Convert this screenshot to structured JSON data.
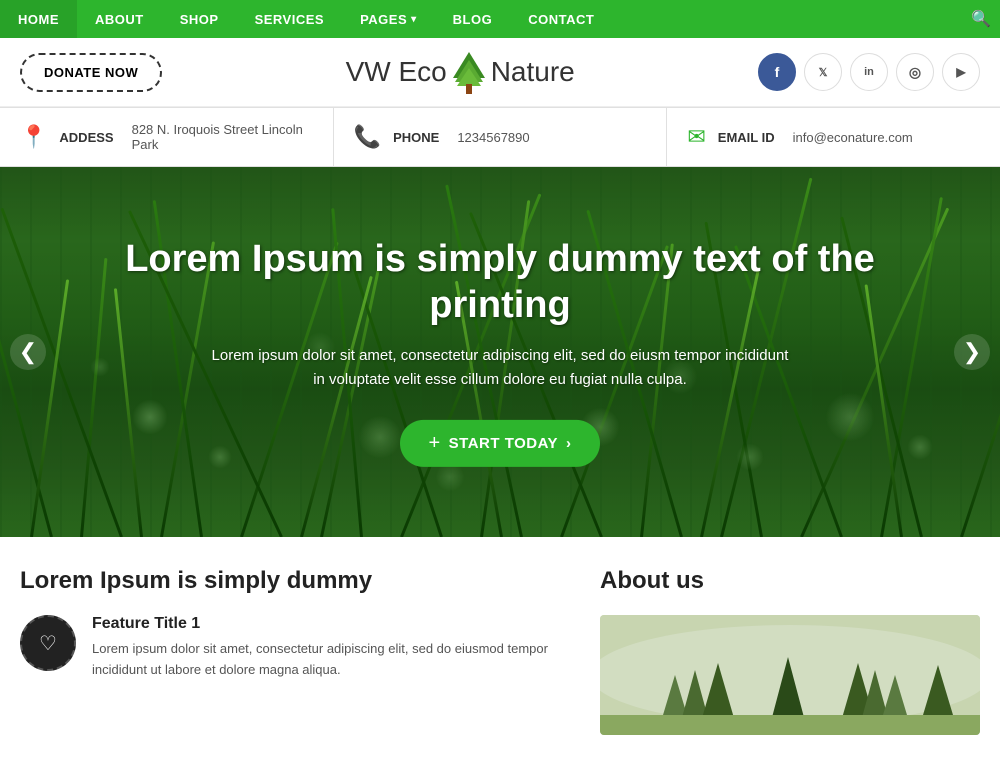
{
  "nav": {
    "items": [
      {
        "label": "HOME",
        "id": "home",
        "hasDropdown": false
      },
      {
        "label": "ABOUT",
        "id": "about",
        "hasDropdown": false
      },
      {
        "label": "SHOP",
        "id": "shop",
        "hasDropdown": false
      },
      {
        "label": "SERVICES",
        "id": "services",
        "hasDropdown": false
      },
      {
        "label": "PAGES",
        "id": "pages",
        "hasDropdown": true
      },
      {
        "label": "BLOG",
        "id": "blog",
        "hasDropdown": false
      },
      {
        "label": "CONTACT",
        "id": "contact",
        "hasDropdown": false
      }
    ]
  },
  "header": {
    "donate_label": "DONATE NOW",
    "logo_text_before": "VW Eco",
    "logo_text_after": "Nature"
  },
  "social": {
    "items": [
      {
        "id": "facebook",
        "symbol": "f",
        "label": "Facebook"
      },
      {
        "id": "twitter",
        "symbol": "𝕏",
        "label": "Twitter"
      },
      {
        "id": "linkedin",
        "symbol": "in",
        "label": "LinkedIn"
      },
      {
        "id": "instagram",
        "symbol": "◎",
        "label": "Instagram"
      },
      {
        "id": "youtube",
        "symbol": "▶",
        "label": "YouTube"
      }
    ]
  },
  "infobar": {
    "items": [
      {
        "icon": "📍",
        "label": "ADDESS",
        "value": "828 N. Iroquois Street Lincoln Park"
      },
      {
        "icon": "📞",
        "label": "PHONE",
        "value": "1234567890"
      },
      {
        "icon": "✉",
        "label": "EMAIL ID",
        "value": "info@econature.com"
      }
    ]
  },
  "hero": {
    "title": "Lorem Ipsum is simply dummy text of the printing",
    "subtitle_line1": "Lorem ipsum dolor sit amet, consectetur adipiscing elit, sed do eiusm tempor incididunt",
    "subtitle_line2": "in voluptate velit esse cillum dolore eu fugiat nulla culpa.",
    "btn_label": "START TODAY",
    "btn_arrow": "❯",
    "prev_label": "❮",
    "next_label": "❯"
  },
  "lower_left": {
    "title": "Lorem Ipsum is simply dummy",
    "feature": {
      "title": "Feature Title 1",
      "icon": "♡",
      "desc": "Lorem ipsum dolor sit amet, consectetur adipiscing elit, sed do eiusmod tempor incididunt ut labore et dolore magna aliqua."
    }
  },
  "lower_right": {
    "title": "About us"
  },
  "colors": {
    "green": "#2db52d",
    "dark": "#222222"
  }
}
